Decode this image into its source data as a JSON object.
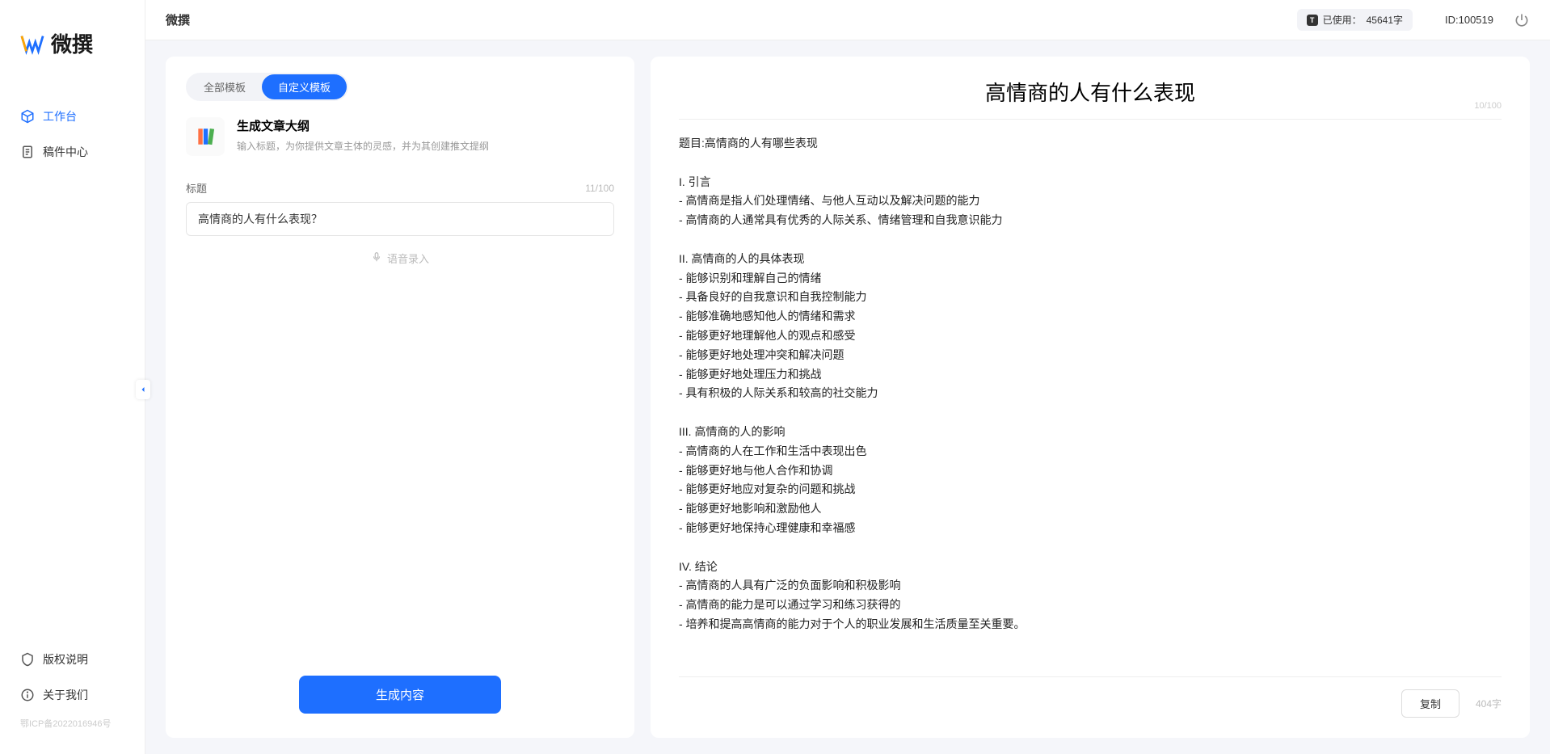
{
  "brand": {
    "name": "微撰"
  },
  "sidebar": {
    "items": [
      {
        "label": "工作台",
        "icon": "cube"
      },
      {
        "label": "稿件中心",
        "icon": "doc"
      }
    ],
    "bottom": [
      {
        "label": "版权说明",
        "icon": "shield"
      },
      {
        "label": "关于我们",
        "icon": "info"
      }
    ],
    "icp": "鄂ICP备2022016946号"
  },
  "topbar": {
    "title": "微撰",
    "usage_prefix": "已使用：",
    "usage_value": "45641字",
    "account_id": "ID:100519"
  },
  "left": {
    "tabs": [
      "全部模板",
      "自定义模板"
    ],
    "template": {
      "title": "生成文章大纲",
      "desc": "输入标题，为你提供文章主体的灵感，并为其创建推文提纲"
    },
    "field_label": "标题",
    "char_counter": "11/100",
    "input_value": "高情商的人有什么表现？",
    "voice_label": "语音录入",
    "generate": "生成内容"
  },
  "right": {
    "title": "高情商的人有什么表现",
    "title_counter": "10/100",
    "body": "题目:高情商的人有哪些表现\n\nI. 引言\n- 高情商是指人们处理情绪、与他人互动以及解决问题的能力\n- 高情商的人通常具有优秀的人际关系、情绪管理和自我意识能力\n\nII. 高情商的人的具体表现\n- 能够识别和理解自己的情绪\n- 具备良好的自我意识和自我控制能力\n- 能够准确地感知他人的情绪和需求\n- 能够更好地理解他人的观点和感受\n- 能够更好地处理冲突和解决问题\n- 能够更好地处理压力和挑战\n- 具有积极的人际关系和较高的社交能力\n\nIII. 高情商的人的影响\n- 高情商的人在工作和生活中表现出色\n- 能够更好地与他人合作和协调\n- 能够更好地应对复杂的问题和挑战\n- 能够更好地影响和激励他人\n- 能够更好地保持心理健康和幸福感\n\nIV. 结论\n- 高情商的人具有广泛的负面影响和积极影响\n- 高情商的能力是可以通过学习和练习获得的\n- 培养和提高高情商的能力对于个人的职业发展和生活质量至关重要。",
    "copy": "复制",
    "char_count": "404字"
  }
}
